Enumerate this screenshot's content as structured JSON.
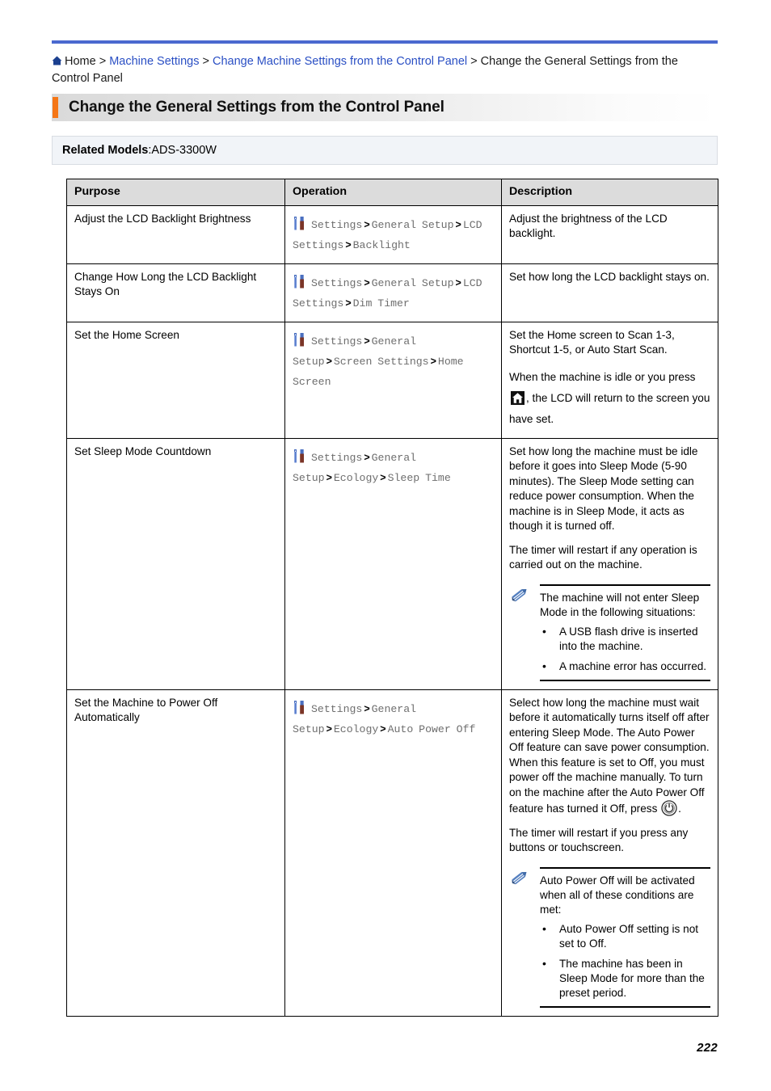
{
  "document": {
    "page_number": "222",
    "accent_color": "#f57616",
    "rule_color": "#4a69cf",
    "link_color": "#2a4fc4"
  },
  "breadcrumb": {
    "home_icon": "home-icon",
    "items": [
      {
        "label": "Home",
        "link": false
      },
      {
        "label": "Machine Settings",
        "link": true
      },
      {
        "label": "Change Machine Settings from the Control Panel",
        "link": true
      },
      {
        "label": "Change the General Settings from the Control Panel",
        "link": false
      }
    ],
    "separator": ">"
  },
  "title": "Change the General Settings from the Control Panel",
  "related_models": {
    "label": "Related Models",
    "colon": ": ",
    "value": "ADS-3300W"
  },
  "table": {
    "headers": [
      "Purpose",
      "Operation",
      "Description"
    ],
    "rows": [
      {
        "purpose": "Adjust the LCD Backlight Brightness",
        "operation": {
          "icon": "settings-wrench-screwdriver-icon",
          "segments": [
            "Settings",
            "General Setup",
            "LCD Settings",
            "Backlight"
          ]
        },
        "description_paragraphs": [
          "Adjust the brightness of the LCD backlight."
        ],
        "note": null
      },
      {
        "purpose": "Change How Long the LCD Backlight Stays On",
        "operation": {
          "icon": "settings-wrench-screwdriver-icon",
          "segments": [
            "Settings",
            "General Setup",
            "LCD Settings",
            "Dim Timer"
          ]
        },
        "description_paragraphs": [
          "Set how long the LCD backlight stays on."
        ],
        "note": null
      },
      {
        "purpose": "Set the Home Screen",
        "operation": {
          "icon": "settings-wrench-screwdriver-icon",
          "segments": [
            "Settings",
            "General Setup",
            "Screen Settings",
            "Home Screen"
          ]
        },
        "description_paragraphs": [
          "Set the Home screen to Scan 1-3, Shortcut 1-5, or Auto Start Scan.",
          "When the machine is idle or you press ",
          ", the LCD will return to the screen you have set."
        ],
        "inline_icon": "home-button-icon",
        "note": null
      },
      {
        "purpose": "Set Sleep Mode Countdown",
        "operation": {
          "icon": "settings-wrench-screwdriver-icon",
          "segments": [
            "Settings",
            "General Setup",
            "Ecology",
            "Sleep Time"
          ]
        },
        "description_paragraphs": [
          "Set how long the machine must be idle before it goes into Sleep Mode (5-90 minutes). The Sleep Mode setting can reduce power consumption. When the machine is in Sleep Mode, it acts as though it is turned off.",
          "The timer will restart if any operation is carried out on the machine."
        ],
        "note": {
          "icon": "pencil-note-icon",
          "intro": "The machine will not enter Sleep Mode in the following situations:",
          "items": [
            "A USB flash drive is inserted into the machine.",
            "A machine error has occurred."
          ]
        }
      },
      {
        "purpose": "Set the Machine to Power Off Automatically",
        "operation": {
          "icon": "settings-wrench-screwdriver-icon",
          "segments": [
            "Settings",
            "General Setup",
            "Ecology",
            "Auto Power Off"
          ]
        },
        "description_paragraphs": [
          "Select how long the machine must wait before it automatically turns itself off after entering Sleep Mode. The Auto Power Off feature can save power consumption. When this feature is set to Off, you must power off the machine manually. To turn on the machine after the Auto Power Off feature has turned it Off, press ",
          ".",
          "The timer will restart if you press any buttons or touchscreen."
        ],
        "inline_icon": "power-button-icon",
        "note": {
          "icon": "pencil-note-icon",
          "intro": "Auto Power Off will be activated when all of these conditions are met:",
          "items": [
            "Auto Power Off setting is not set to Off.",
            "The machine has been in Sleep Mode for more than the preset period."
          ]
        }
      }
    ]
  }
}
